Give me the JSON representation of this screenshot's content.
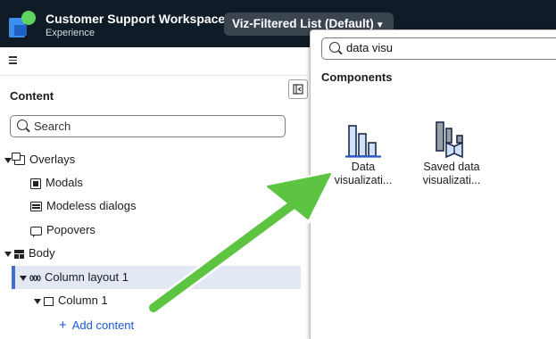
{
  "header": {
    "app_title": "Customer Support Workspace",
    "app_subtitle": "Experience",
    "view_selector": "Viz-Filtered List (Default)",
    "view_caret": "▼"
  },
  "left_panel": {
    "heading": "Content",
    "search_placeholder": "Search",
    "tree": {
      "overlays": "Overlays",
      "modals": "Modals",
      "modeless": "Modeless dialogs",
      "popovers": "Popovers",
      "body": "Body",
      "column_layout": "Column layout 1",
      "column": "Column 1",
      "add_content": "Add content",
      "column_layout_icon_text": "000"
    }
  },
  "popup": {
    "search_value": "data visu",
    "section_heading": "Components",
    "tiles": [
      {
        "line1": "Data",
        "line2": "visualizati..."
      },
      {
        "line1": "Saved data",
        "line2": "visualizati..."
      }
    ]
  },
  "colors": {
    "header_bg": "#0f1b26",
    "accent_blue": "#3f6fd1",
    "link_blue": "#1a5bd6",
    "arrow_green": "#5dc442"
  },
  "icons": [
    "menu-icon",
    "collapse-panel-icon",
    "search-icon",
    "overlay-icon",
    "modal-icon",
    "modeless-dialog-icon",
    "popover-icon",
    "body-layout-icon",
    "column-layout-icon",
    "column-icon",
    "plus-icon",
    "data-visualization-icon",
    "saved-data-visualization-icon"
  ]
}
